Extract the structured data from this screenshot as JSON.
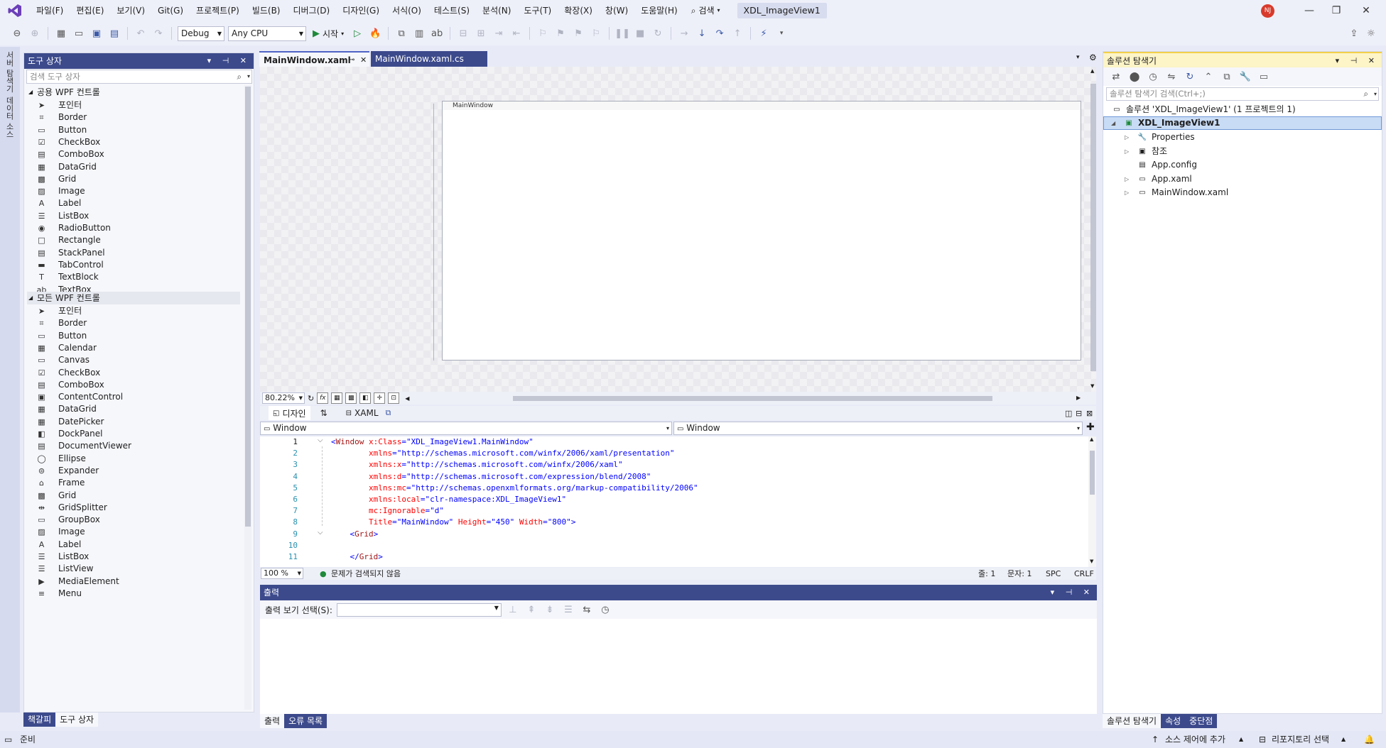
{
  "menu": {
    "items": [
      "파일(F)",
      "편집(E)",
      "보기(V)",
      "Git(G)",
      "프로젝트(P)",
      "빌드(B)",
      "디버그(D)",
      "디자인(G)",
      "서식(O)",
      "테스트(S)",
      "분석(N)",
      "도구(T)",
      "확장(X)",
      "창(W)",
      "도움말(H)"
    ],
    "search_label": "검색",
    "solution_title": "XDL_ImageView1",
    "avatar": "NJ"
  },
  "toolbar": {
    "config": "Debug",
    "platform": "Any CPU",
    "start_label": "시작"
  },
  "left_strip": {
    "tabs": [
      "서버 탐색기",
      "데이터 소스"
    ]
  },
  "toolbox": {
    "title": "도구 상자",
    "search_placeholder": "검색 도구 상자",
    "group_common": "공용 WPF 컨트롤",
    "common_items": [
      "포인터",
      "Border",
      "Button",
      "CheckBox",
      "ComboBox",
      "DataGrid",
      "Grid",
      "Image",
      "Label",
      "ListBox",
      "RadioButton",
      "Rectangle",
      "StackPanel",
      "TabControl",
      "TextBlock",
      "TextBox"
    ],
    "group_all": "모든 WPF 컨트롤",
    "all_items": [
      "포인터",
      "Border",
      "Button",
      "Calendar",
      "Canvas",
      "CheckBox",
      "ComboBox",
      "ContentControl",
      "DataGrid",
      "DatePicker",
      "DockPanel",
      "DocumentViewer",
      "Ellipse",
      "Expander",
      "Frame",
      "Grid",
      "GridSplitter",
      "GroupBox",
      "Image",
      "Label",
      "ListBox",
      "ListView",
      "MediaElement",
      "Menu"
    ],
    "bottom_tabs": [
      "책갈피",
      "도구 상자"
    ]
  },
  "doc_tabs": [
    {
      "label": "MainWindow.xaml"
    },
    {
      "label": "MainWindow.xaml.cs"
    }
  ],
  "designer": {
    "window_title": "MainWindow",
    "zoom": "80.22%",
    "fx": "fx",
    "split_design": "디자인",
    "split_xaml": "XAML"
  },
  "xaml_nav": {
    "left": "Window",
    "right": "Window"
  },
  "code_lines": [
    {
      "n": "1",
      "parts": [
        [
          "brk",
          "<"
        ],
        [
          "tagc",
          "Window"
        ],
        [
          "attrc",
          " x:Class"
        ],
        [
          "brk",
          "="
        ],
        [
          "valc",
          "\"XDL_ImageView1.MainWindow\""
        ]
      ]
    },
    {
      "n": "2",
      "parts": [
        [
          "attrc",
          "        xmlns"
        ],
        [
          "brk",
          "="
        ],
        [
          "valc",
          "\"http://schemas.microsoft.com/winfx/2006/xaml/presentation\""
        ]
      ]
    },
    {
      "n": "3",
      "parts": [
        [
          "attrc",
          "        xmlns:x"
        ],
        [
          "brk",
          "="
        ],
        [
          "valc",
          "\"http://schemas.microsoft.com/winfx/2006/xaml\""
        ]
      ]
    },
    {
      "n": "4",
      "parts": [
        [
          "attrc",
          "        xmlns:d"
        ],
        [
          "brk",
          "="
        ],
        [
          "valc",
          "\"http://schemas.microsoft.com/expression/blend/2008\""
        ]
      ]
    },
    {
      "n": "5",
      "parts": [
        [
          "attrc",
          "        xmlns:mc"
        ],
        [
          "brk",
          "="
        ],
        [
          "valc",
          "\"http://schemas.openxmlformats.org/markup-compatibility/2006\""
        ]
      ]
    },
    {
      "n": "6",
      "parts": [
        [
          "attrc",
          "        xmlns:local"
        ],
        [
          "brk",
          "="
        ],
        [
          "valc",
          "\"clr-namespace:XDL_ImageView1\""
        ]
      ]
    },
    {
      "n": "7",
      "parts": [
        [
          "attrc",
          "        mc:Ignorable"
        ],
        [
          "brk",
          "="
        ],
        [
          "valc",
          "\"d\""
        ]
      ]
    },
    {
      "n": "8",
      "parts": [
        [
          "attrc",
          "        Title"
        ],
        [
          "brk",
          "="
        ],
        [
          "valc",
          "\"MainWindow\""
        ],
        [
          "attrc",
          " Height"
        ],
        [
          "brk",
          "="
        ],
        [
          "valc",
          "\"450\""
        ],
        [
          "attrc",
          " Width"
        ],
        [
          "brk",
          "="
        ],
        [
          "valc",
          "\"800\""
        ],
        [
          "brk",
          ">"
        ]
      ]
    },
    {
      "n": "9",
      "parts": [
        [
          "brk",
          "    <"
        ],
        [
          "tagc",
          "Grid"
        ],
        [
          "brk",
          ">"
        ]
      ]
    },
    {
      "n": "10",
      "parts": [
        [
          "brk",
          ""
        ]
      ]
    },
    {
      "n": "11",
      "parts": [
        [
          "brk",
          "    </"
        ],
        [
          "tagc",
          "Grid"
        ],
        [
          "brk",
          ">"
        ]
      ]
    }
  ],
  "editor_status": {
    "zoom": "100 %",
    "issues": "문제가 검색되지 않음",
    "line": "줄: 1",
    "col": "문자: 1",
    "spc": "SPC",
    "eol": "CRLF"
  },
  "output": {
    "title": "출력",
    "select_label": "출력 보기 선택(S):",
    "bottom_tabs": [
      "출력",
      "오류 목록"
    ]
  },
  "solution_explorer": {
    "title": "솔루션 탐색기",
    "search_placeholder": "솔루션 탐색기 검색(Ctrl+;)",
    "solution_node": "솔루션 'XDL_ImageView1' (1 프로젝트의 1)",
    "project": "XDL_ImageView1",
    "items": [
      "Properties",
      "참조",
      "App.config",
      "App.xaml",
      "MainWindow.xaml"
    ],
    "bottom_tabs": [
      "솔루션 탐색기",
      "속성",
      "중단점"
    ]
  },
  "statusbar": {
    "ready": "준비",
    "source_control": "소스 제어에 추가",
    "repository": "리포지토리 선택"
  },
  "colors": {
    "accent": "#3c4a8c",
    "tab_active_border": "#4f63c5"
  }
}
